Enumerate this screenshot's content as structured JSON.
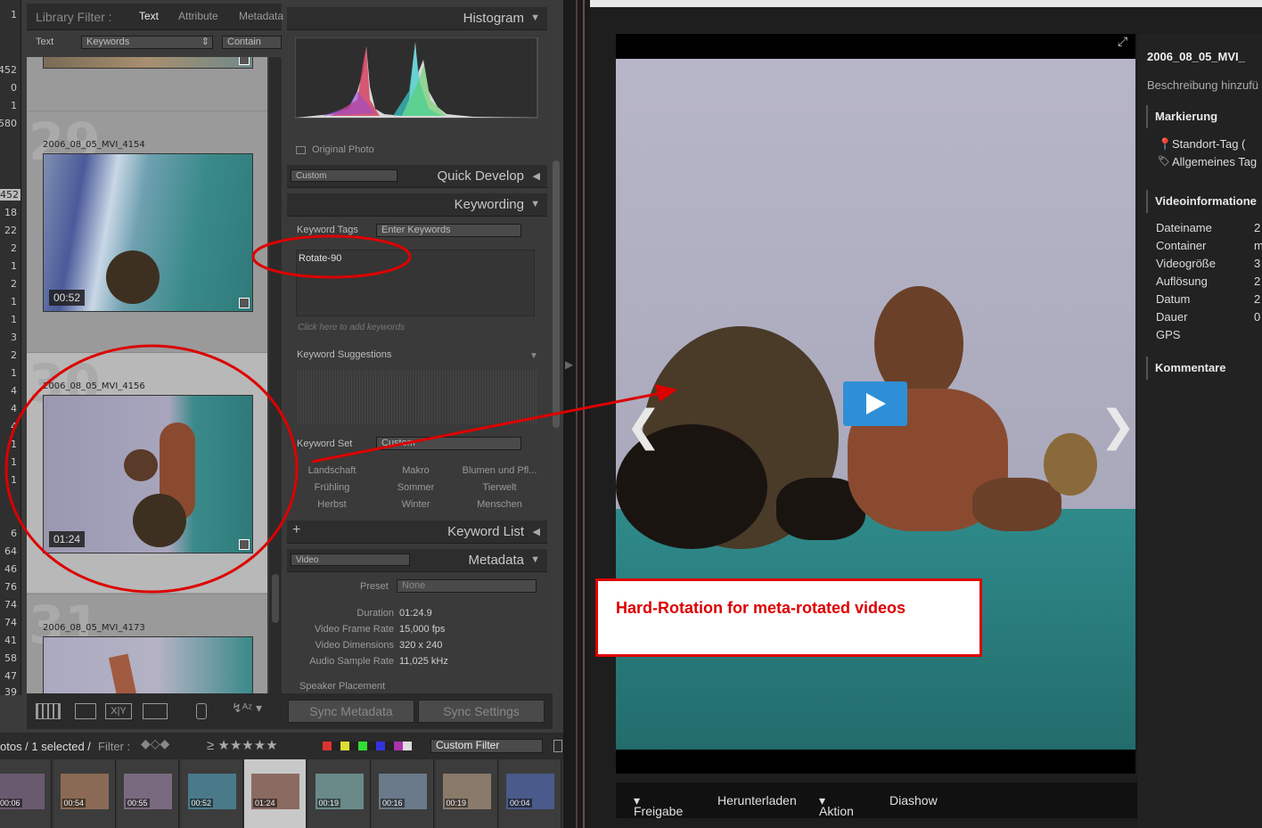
{
  "library_filter": {
    "title": "Library Filter :",
    "tabs": [
      "Text",
      "Attribute",
      "Metadata"
    ],
    "row": {
      "label": "Text",
      "field": "Keywords",
      "rule": "Contain"
    }
  },
  "left_numbers": [
    "1",
    "452",
    "0",
    "1",
    "580",
    "452",
    "18",
    "22",
    "2",
    "1",
    "2",
    "1",
    "1",
    "3",
    "2",
    "1",
    "4",
    "4",
    "4",
    "1",
    "1",
    "1",
    "6",
    "64",
    "46",
    "76",
    "74",
    "74",
    "41",
    "58",
    "47",
    "39"
  ],
  "grid_cells": [
    {
      "num": "29",
      "name": "2006_08_05_MVI_4154",
      "duration": "00:52"
    },
    {
      "num": "30",
      "name": "2006_08_05_MVI_4156",
      "duration": "01:24"
    },
    {
      "num": "31",
      "name": "2006_08_05_MVI_4173",
      "duration": ""
    }
  ],
  "panels": {
    "histogram": "Histogram",
    "original_photo": "Original Photo",
    "quick_develop": "Quick Develop",
    "quick_develop_preset": "Custom",
    "keywording": "Keywording",
    "keyword_tags_label": "Keyword Tags",
    "keyword_tags_select": "Enter Keywords",
    "keyword_value": "Rotate-90",
    "keyword_placeholder": "Click here to add keywords",
    "keyword_suggestions": "Keyword Suggestions",
    "keyword_set_label": "Keyword Set",
    "keyword_set_value": "Custom",
    "keyword_set_items": [
      "Landschaft",
      "Makro",
      "Blumen und Pfl...",
      "Frühling",
      "Sommer",
      "Tierwelt",
      "Herbst",
      "Winter",
      "Menschen"
    ],
    "keyword_list": "Keyword List",
    "metadata": "Metadata",
    "metadata_preset_select": "Video",
    "preset_label": "Preset",
    "preset_value": "None",
    "meta_rows": [
      {
        "k": "Duration",
        "v": "01:24.9"
      },
      {
        "k": "Video Frame Rate",
        "v": "15,000 fps"
      },
      {
        "k": "Video Dimensions",
        "v": "320 x 240"
      },
      {
        "k": "Audio Sample Rate",
        "v": "11,025 kHz"
      }
    ],
    "speaker_placement": "Speaker Placement"
  },
  "toolbar": {
    "sync_metadata": "Sync Metadata",
    "sync_settings": "Sync Settings"
  },
  "filmbar": {
    "status": "otos / 1 selected /",
    "filter_label": "Filter :",
    "custom_filter": "Custom Filter"
  },
  "filmstrip": [
    "00:06",
    "00:54",
    "00:55",
    "00:52",
    "01:24",
    "00:19",
    "00:16",
    "00:19",
    "00:04"
  ],
  "web": {
    "title": "2006_08_05_MVI_",
    "description": "Beschreibung hinzufü",
    "section_markierung": "Markierung",
    "tag_location": "Standort-Tag (",
    "tag_general": "Allgemeines Tag",
    "section_video": "Videoinformatione",
    "info_rows": [
      {
        "k": "Dateiname",
        "v": "2"
      },
      {
        "k": "Container",
        "v": "m"
      },
      {
        "k": "Videogröße",
        "v": "3"
      },
      {
        "k": "Auflösung",
        "v": "2"
      },
      {
        "k": "Datum",
        "v": "2"
      },
      {
        "k": "Dauer",
        "v": "0"
      },
      {
        "k": "GPS",
        "v": ""
      }
    ],
    "section_comments": "Kommentare",
    "actions": [
      "Freigabe",
      "Herunterladen",
      "Aktion",
      "Diashow"
    ],
    "prev_glyph": "❮",
    "next_glyph": "❯"
  },
  "annotation": "Hard-Rotation for meta-rotated videos",
  "colors": {
    "annotation_red": "#dd0000",
    "play_blue": "#2f8fd6"
  }
}
